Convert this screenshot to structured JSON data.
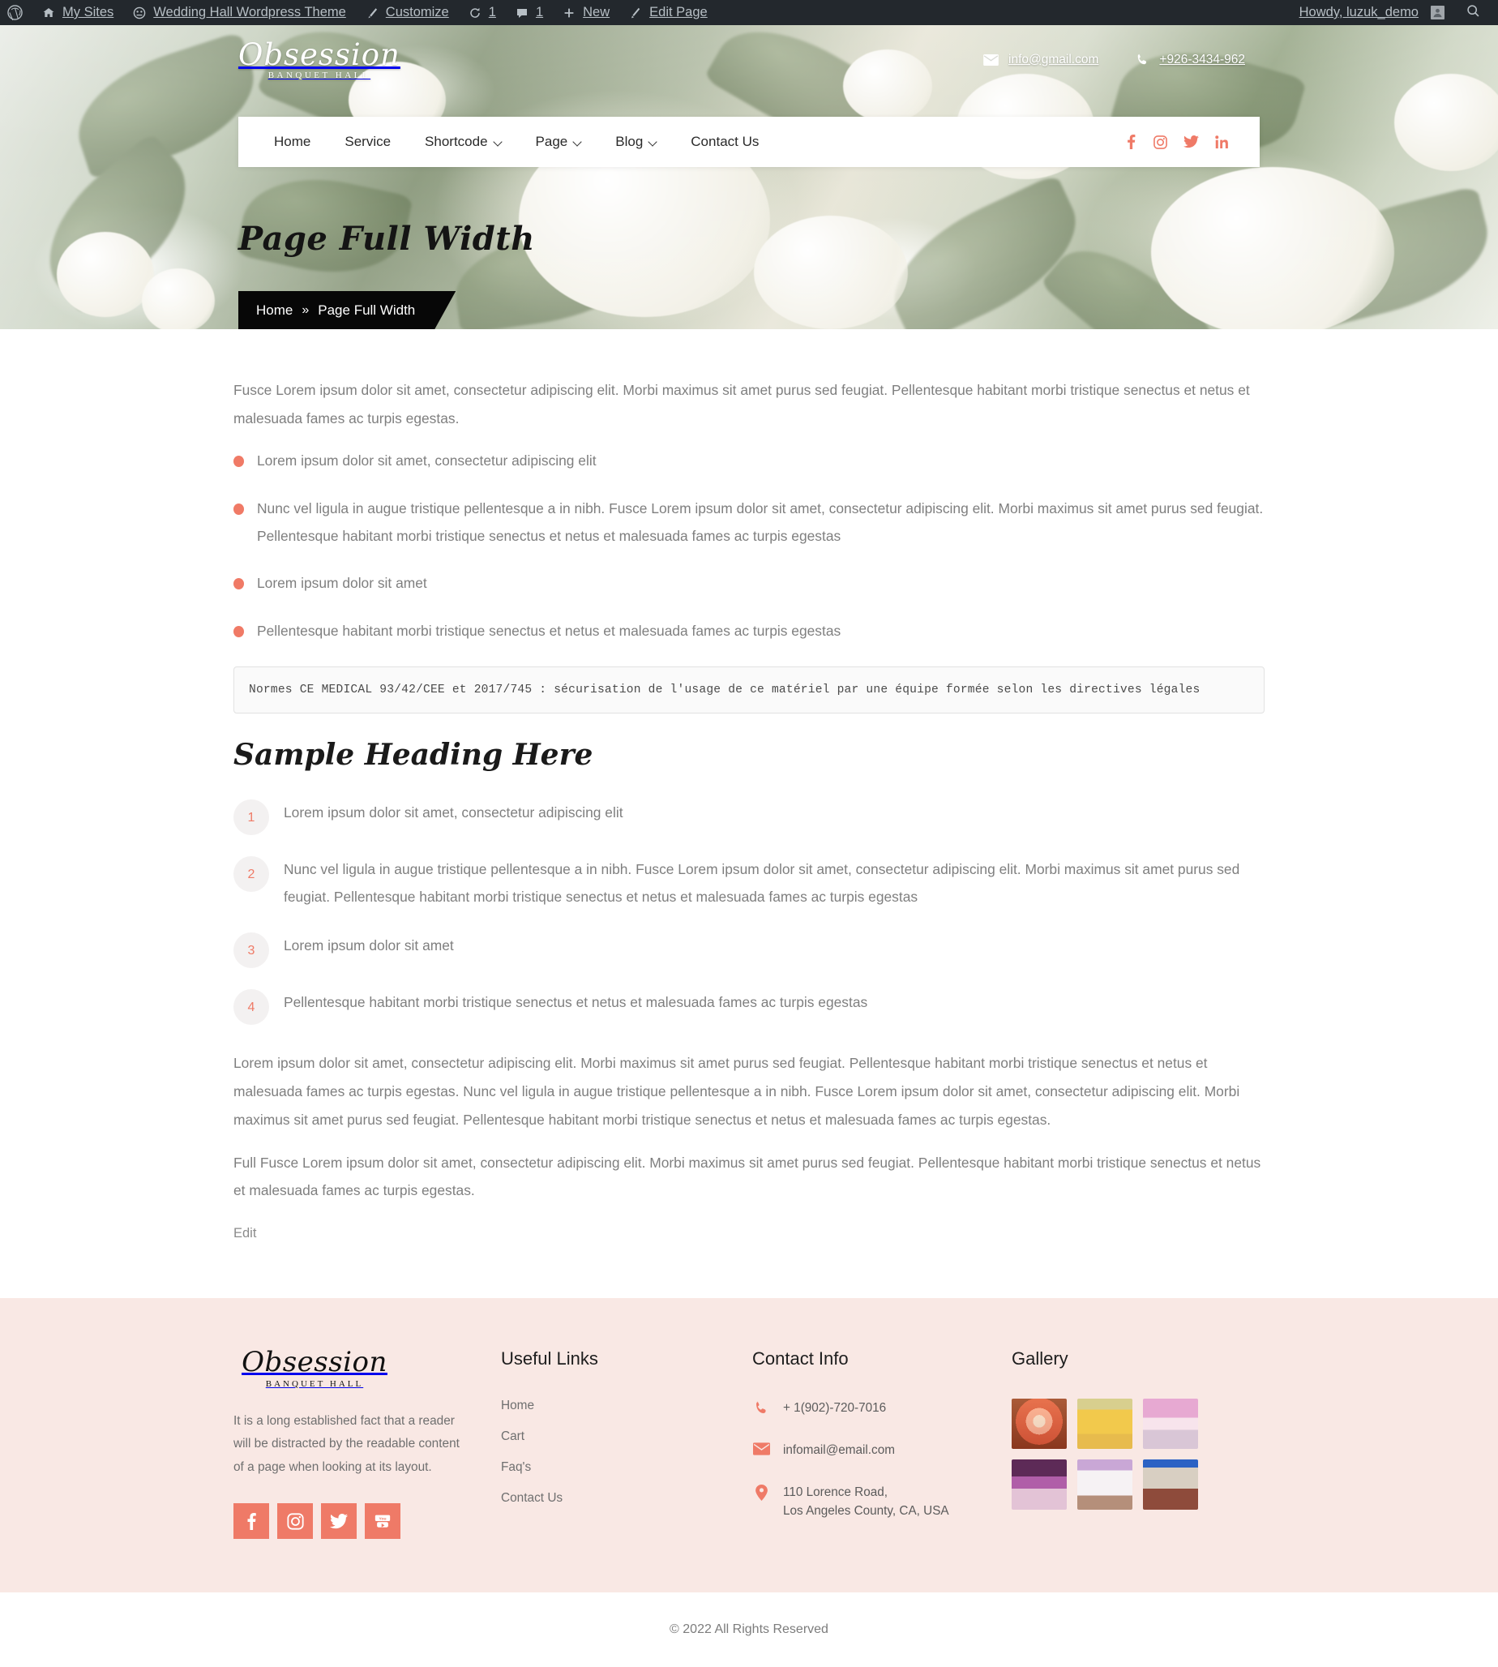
{
  "adminbar": {
    "wp_logo_icon": "wordpress-icon",
    "items": [
      {
        "label": "My Sites",
        "icon": "sites-icon"
      },
      {
        "label": "Wedding Hall Wordpress Theme",
        "icon": "dashboard-icon"
      },
      {
        "label": "Customize",
        "icon": "paintbrush-icon"
      },
      {
        "label": "1",
        "icon": "updates-icon"
      },
      {
        "label": "1",
        "icon": "comments-icon"
      },
      {
        "label": "New",
        "icon": "plus-icon"
      },
      {
        "label": "Edit Page",
        "icon": "pencil-icon"
      }
    ],
    "howdy": "Howdy, luzuk_demo",
    "search_icon": "search-icon"
  },
  "header": {
    "logo_script": "Obsession",
    "logo_sub": "Banquet Hall",
    "email": "info@gmail.com",
    "phone": "+926-3434-962",
    "email_icon": "envelope-icon",
    "phone_icon": "phone-icon",
    "nav": [
      {
        "label": "Home",
        "has_caret": false
      },
      {
        "label": "Service",
        "has_caret": false
      },
      {
        "label": "Shortcode",
        "has_caret": true
      },
      {
        "label": "Page",
        "has_caret": true
      },
      {
        "label": "Blog",
        "has_caret": true
      },
      {
        "label": "Contact Us",
        "has_caret": false
      }
    ],
    "social": [
      "facebook-icon",
      "instagram-icon",
      "twitter-icon",
      "linkedin-icon"
    ]
  },
  "hero": {
    "title": "Page Full Width",
    "breadcrumb_home": "Home",
    "breadcrumb_sep": "»",
    "breadcrumb_current": "Page Full Width"
  },
  "main": {
    "intro": "Fusce Lorem ipsum dolor sit amet, consectetur adipiscing elit. Morbi maximus sit amet purus sed feugiat. Pellentesque habitant morbi tristique senectus et netus et malesuada fames ac turpis egestas.",
    "bullets": [
      "Lorem ipsum dolor sit amet, consectetur adipiscing elit",
      "Nunc vel ligula in augue tristique pellentesque a in nibh. Fusce Lorem ipsum dolor sit amet, consectetur adipiscing elit. Morbi maximus sit amet purus sed feugiat. Pellentesque habitant morbi tristique senectus et netus et malesuada fames ac turpis egestas",
      "Lorem ipsum dolor sit amet",
      "Pellentesque habitant morbi tristique senectus et netus et malesuada fames ac turpis egestas"
    ],
    "code": "Normes CE MEDICAL 93/42/CEE et 2017/745 : sécurisation de l'usage de ce matériel par une équipe formée selon les directives légales",
    "heading": "Sample Heading Here",
    "numbered": [
      {
        "num": "1",
        "text": "Lorem ipsum dolor sit amet, consectetur adipiscing elit"
      },
      {
        "num": "2",
        "text": "Nunc vel ligula in augue tristique pellentesque a in nibh. Fusce Lorem ipsum dolor sit amet, consectetur adipiscing elit. Morbi maximus sit amet purus sed feugiat. Pellentesque habitant morbi tristique senectus et netus et malesuada fames ac turpis egestas"
      },
      {
        "num": "3",
        "text": "Lorem ipsum dolor sit amet"
      },
      {
        "num": "4",
        "text": "Pellentesque habitant morbi tristique senectus et netus et malesuada fames ac turpis egestas"
      }
    ],
    "para_1": "Lorem ipsum dolor sit amet, consectetur adipiscing elit. Morbi maximus sit amet purus sed feugiat. Pellentesque habitant morbi tristique senectus et netus et malesuada fames ac turpis egestas. Nunc vel ligula in augue tristique pellentesque a in nibh. Fusce Lorem ipsum dolor sit amet, consectetur adipiscing elit. Morbi maximus sit amet purus sed feugiat. Pellentesque habitant morbi tristique senectus et netus et malesuada fames ac turpis egestas.",
    "para_2": "Full Fusce Lorem ipsum dolor sit amet, consectetur adipiscing elit. Morbi maximus sit amet purus sed feugiat. Pellentesque habitant morbi tristique senectus et netus et malesuada fames ac turpis egestas.",
    "edit": "Edit"
  },
  "footer": {
    "logo_script": "Obsession",
    "logo_sub": "Banquet Hall",
    "description": "It is a long established fact that a reader will be distracted by the readable content of a page when looking at its layout.",
    "social": [
      "facebook-icon",
      "instagram-icon",
      "twitter-icon",
      "youtube-icon"
    ],
    "useful_links_title": "Useful Links",
    "useful_links": [
      "Home",
      "Cart",
      "Faq's",
      "Contact Us"
    ],
    "contact_title": "Contact Info",
    "contact": [
      {
        "icon": "phone-icon",
        "text": "+ 1(902)-720-7016"
      },
      {
        "icon": "envelope-icon",
        "text": "infomail@email.com"
      },
      {
        "icon": "map-pin-icon",
        "line1": "110 Lorence Road,",
        "line2": "Los Angeles County, CA, USA"
      }
    ],
    "gallery_title": "Gallery",
    "gallery_items": [
      "banquet-hall-thumb-1",
      "banquet-hall-thumb-2",
      "banquet-hall-thumb-3",
      "banquet-hall-thumb-4",
      "banquet-hall-thumb-5",
      "banquet-hall-thumb-6"
    ],
    "copyright": "© 2022 All Rights Reserved"
  },
  "colors": {
    "accent": "#ef7a67",
    "footer_bg": "#f9e8e4",
    "adminbar_bg": "#23282d",
    "breadcrumb_bg": "#070707"
  }
}
